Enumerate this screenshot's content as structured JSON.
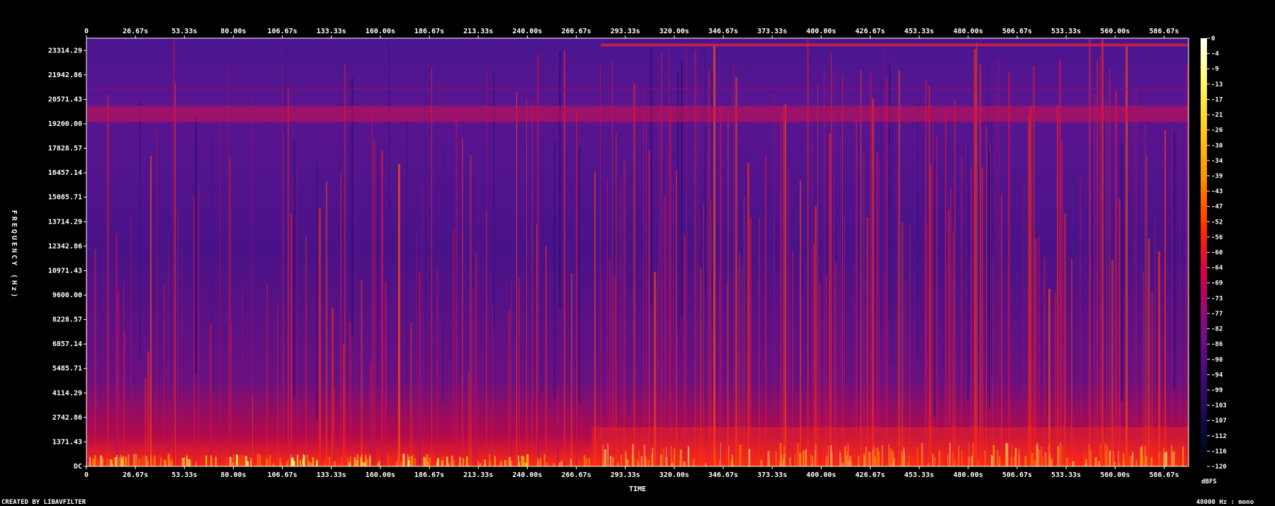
{
  "chart_data": {
    "type": "heatmap",
    "title": "",
    "xlabel": "TIME",
    "ylabel": "FREQUENCY (Hz)",
    "x_ticks": [
      "0",
      "26.67s",
      "53.33s",
      "80.00s",
      "106.67s",
      "133.33s",
      "160.00s",
      "186.67s",
      "213.33s",
      "240.00s",
      "266.67s",
      "293.33s",
      "320.00s",
      "346.67s",
      "373.33s",
      "400.00s",
      "426.67s",
      "453.33s",
      "480.00s",
      "506.67s",
      "533.33s",
      "560.00s",
      "586.67s"
    ],
    "x_tick_values": [
      0,
      26.67,
      53.33,
      80.0,
      106.67,
      133.33,
      160.0,
      186.67,
      213.33,
      240.0,
      266.67,
      293.33,
      320.0,
      346.67,
      373.33,
      400.0,
      426.67,
      453.33,
      480.0,
      506.67,
      533.33,
      560.0,
      586.67
    ],
    "xlim": [
      0,
      600
    ],
    "y_ticks": [
      "DC",
      "1371.43",
      "2742.86",
      "4114.29",
      "5485.71",
      "6857.14",
      "8228.57",
      "9600.00",
      "10971.43",
      "12342.86",
      "13714.29",
      "15085.71",
      "16457.14",
      "17828.57",
      "19200.00",
      "20571.43",
      "21942.86",
      "23314.29"
    ],
    "y_tick_values": [
      0,
      1371.43,
      2742.86,
      4114.29,
      5485.71,
      6857.14,
      8228.57,
      9600.0,
      10971.43,
      12342.86,
      13714.29,
      15085.71,
      16457.14,
      17828.57,
      19200.0,
      20571.43,
      21942.86,
      23314.29
    ],
    "ylim": [
      0,
      24000
    ],
    "colorbar": {
      "label": "dBFS",
      "ticks": [
        "0",
        "-4",
        "-9",
        "-13",
        "-17",
        "-21",
        "-26",
        "-30",
        "-34",
        "-39",
        "-43",
        "-47",
        "-52",
        "-56",
        "-60",
        "-64",
        "-69",
        "-73",
        "-77",
        "-82",
        "-86",
        "-90",
        "-94",
        "-99",
        "-103",
        "-107",
        "-112",
        "-116",
        "-120"
      ],
      "range": [
        0,
        -120
      ],
      "colors": [
        "#ffffff",
        "#ffff80",
        "#ffd21e",
        "#ff8c00",
        "#ff2800",
        "#d20050",
        "#7c0c8c",
        "#3c0a78",
        "#0a0a3c",
        "#000000"
      ]
    }
  },
  "footer": {
    "left": "CREATED BY LIBAVFILTER",
    "right": "48000 Hz : mono"
  }
}
